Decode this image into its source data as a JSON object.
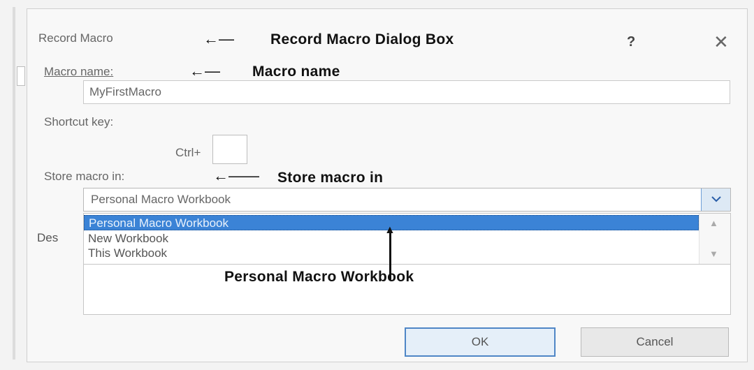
{
  "dialog": {
    "title": "Record Macro",
    "help_glyph": "?",
    "close_glyph": "✕"
  },
  "annotations": {
    "title_arrow": "←—",
    "dialog_label": "Record Macro Dialog Box",
    "name_arrow": "←—",
    "name_label": "Macro name",
    "store_arrow": "←——",
    "store_label": "Store macro in",
    "workbook_label": "Personal Macro Workbook"
  },
  "macro_name": {
    "label": "Macro name:",
    "value": "MyFirstMacro"
  },
  "shortcut": {
    "label": "Shortcut key:",
    "prefix": "Ctrl+",
    "value": ""
  },
  "store_in": {
    "label": "Store macro in:",
    "selected": "Personal Macro Workbook",
    "options": [
      "Personal Macro Workbook",
      "New Workbook",
      "This Workbook"
    ]
  },
  "description": {
    "label_partial": "Des"
  },
  "buttons": {
    "ok": "OK",
    "cancel": "Cancel"
  },
  "icons": {
    "dropdown": "chevron-down-icon",
    "scroll_up": "triangle-up-icon",
    "scroll_down": "triangle-down-icon",
    "close": "close-icon",
    "help": "help-icon"
  }
}
